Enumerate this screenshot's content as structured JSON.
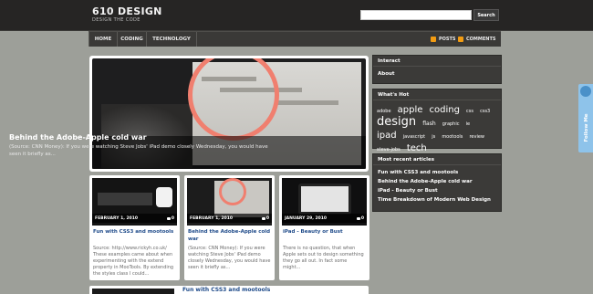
{
  "site": {
    "title": "610 DESIGN",
    "tagline": "DESIGN THE CODE"
  },
  "search": {
    "placeholder": "",
    "button": "Search"
  },
  "nav": [
    {
      "label": "HOME"
    },
    {
      "label": "CODING"
    },
    {
      "label": "TECHNOLOGY"
    }
  ],
  "feeds": {
    "posts": "POSTS",
    "comments": "COMMENTS"
  },
  "feature": {
    "title": "Behind the Adobe-Apple cold war",
    "excerpt": "(Source: CNN Money): If you were watching Steve Jobs' iPad demo closely Wednesday, you would have seen it briefly as..."
  },
  "cards": [
    {
      "date": "FEBRUARY 1, 2010",
      "comments": "0",
      "title": "Fun with CSS3 and mootools",
      "text": "Source: http://www.rickyh.co.uk/ These examples came about when experimenting with the extend property in MooTools. By extending the styles class I could..."
    },
    {
      "date": "FEBRUARY 1, 2010",
      "comments": "0",
      "title": "Behind the Adobe-Apple cold war",
      "text": "(Source: CNN Money): If you were watching Steve Jobs' iPad demo closely Wednesday, you would have seen it briefly as..."
    },
    {
      "date": "JANUARY 29, 2010",
      "comments": "0",
      "title": "iPad - Beauty or Bust",
      "text": "There is no question, that when Apple sets out to design something they go all out. In fact some might..."
    }
  ],
  "bottom_card": {
    "title": "Fun with CSS3 and mootools"
  },
  "sidebar": {
    "interact": {
      "heading": "Interact",
      "items": [
        {
          "label": "About"
        }
      ]
    },
    "hot": {
      "heading": "What's Hot",
      "tags": [
        {
          "label": "adobe",
          "size": 5
        },
        {
          "label": "apple",
          "size": 10
        },
        {
          "label": "coding",
          "size": 10
        },
        {
          "label": "css",
          "size": 5
        },
        {
          "label": "css3",
          "size": 5
        },
        {
          "label": "design",
          "size": 13
        },
        {
          "label": "flash",
          "size": 6
        },
        {
          "label": "graphic",
          "size": 5
        },
        {
          "label": "ie",
          "size": 5
        },
        {
          "label": "ipad",
          "size": 10
        },
        {
          "label": "javascript",
          "size": 5
        },
        {
          "label": "js",
          "size": 5
        },
        {
          "label": "mootools",
          "size": 5
        },
        {
          "label": "review",
          "size": 5
        },
        {
          "label": "steve-jobs",
          "size": 5
        },
        {
          "label": "tech",
          "size": 10
        }
      ]
    },
    "recent": {
      "heading": "Most recent articles",
      "items": [
        {
          "label": "Fun with CSS3 and mootools"
        },
        {
          "label": "Behind the Adobe-Apple cold war"
        },
        {
          "label": "iPad - Beauty or Bust"
        },
        {
          "label": "Time Breakdown of Modern Web Design"
        }
      ]
    }
  },
  "follow": {
    "label": "Follow Me"
  }
}
